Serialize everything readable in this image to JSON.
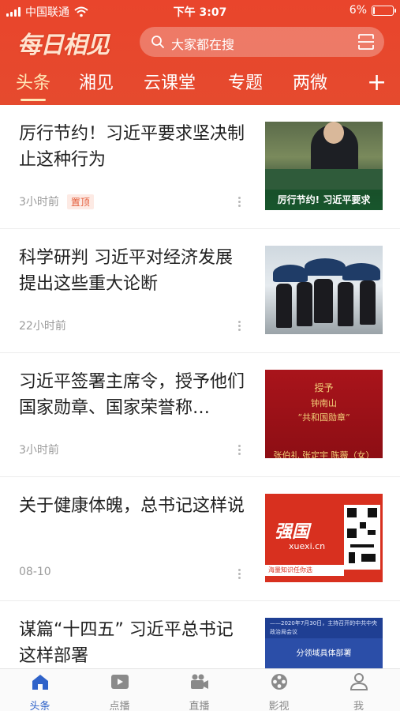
{
  "status_bar": {
    "carrier": "中国联通",
    "time": "下午 3:07",
    "battery": "6%",
    "battery_level": 0.06
  },
  "header": {
    "logo": "每日相见",
    "search_placeholder": "大家都在搜",
    "accent_color": "#e9452c"
  },
  "tabs": [
    {
      "label": "头条",
      "active": true
    },
    {
      "label": "湘见",
      "active": false
    },
    {
      "label": "云课堂",
      "active": false
    },
    {
      "label": "专题",
      "active": false
    },
    {
      "label": "两微",
      "active": false
    }
  ],
  "add_tab_label": "+",
  "news": [
    {
      "title": "厉行节约！习近平要求坚决制止这种行为",
      "time": "3小时前",
      "tag": "置顶",
      "thumb_caption": "厉行节约! 习近平要求"
    },
    {
      "title": "科学研判 习近平对经济发展提出这些重大论断",
      "time": "22小时前"
    },
    {
      "title": "习近平签署主席令，授予他们国家勋章、国家荣誉称…",
      "time": "3小时前",
      "thumb_lines": [
        "授予",
        "钟南山",
        "“共和国勋章”",
        "张伯礼 张定宇 陈薇（女）"
      ]
    },
    {
      "title": "关于健康体魄，总书记这样说",
      "time": "08-10",
      "thumb_brand": "强国",
      "thumb_domain": "xuexi.cn",
      "thumb_strip": "海量知识任你选"
    },
    {
      "title": "谋篇“十四五”    习近平总书记这样部署",
      "thumb_top": "——2020年7月30日，主持召开的中共中央政治局会议",
      "thumb_bar": "分领域具体部署"
    }
  ],
  "bottom_nav": [
    {
      "label": "头条",
      "icon": "home-icon",
      "active": true
    },
    {
      "label": "点播",
      "icon": "play-icon",
      "active": false
    },
    {
      "label": "直播",
      "icon": "video-camera-icon",
      "active": false
    },
    {
      "label": "影视",
      "icon": "film-reel-icon",
      "active": false
    },
    {
      "label": "我",
      "icon": "user-icon",
      "active": false
    }
  ],
  "nav_active_color": "#2f62c9"
}
